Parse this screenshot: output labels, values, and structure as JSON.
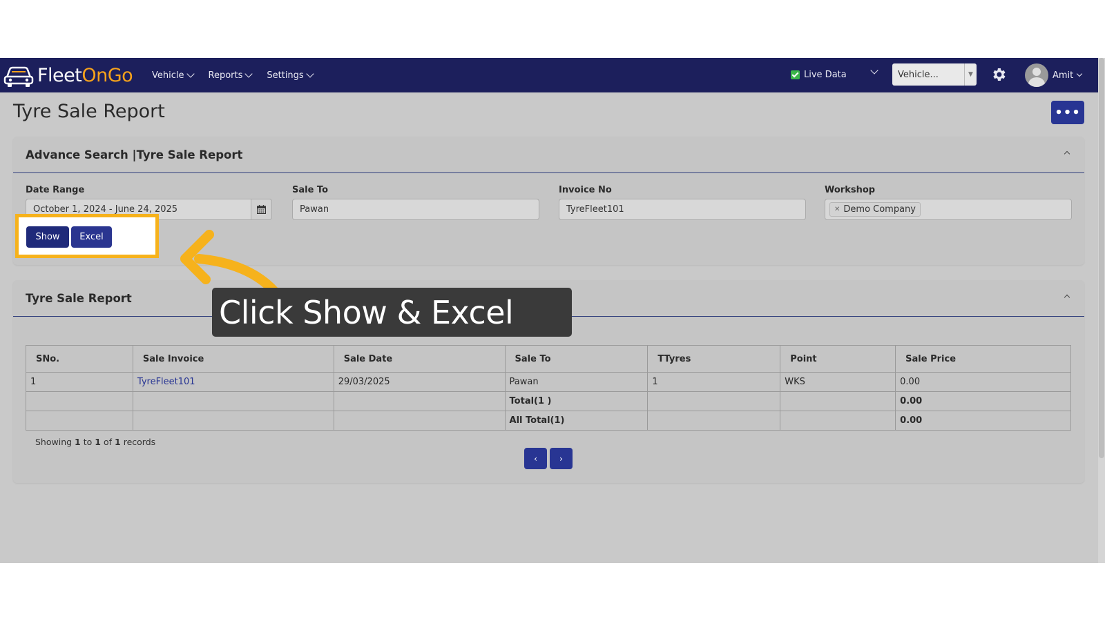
{
  "brand": {
    "fleet": "Fleet",
    "ongo": "OnGo"
  },
  "nav": {
    "items": [
      {
        "label": "Vehicle"
      },
      {
        "label": "Reports"
      },
      {
        "label": "Settings"
      }
    ]
  },
  "header": {
    "live_data_label": "Live Data",
    "vehicle_placeholder": "Vehicle...",
    "user_name": "Amit"
  },
  "page": {
    "title": "Tyre Sale Report",
    "more_label": "•••"
  },
  "search": {
    "title": "Advance Search |Tyre Sale Report",
    "date_range_label": "Date Range",
    "date_range_value": "October 1, 2024 - June 24, 2025",
    "sale_to_label": "Sale To",
    "sale_to_value": "Pawan",
    "invoice_label": "Invoice No",
    "invoice_value": "TyreFleet101",
    "workshop_label": "Workshop",
    "workshop_tag": "Demo Company",
    "show_label": "Show",
    "excel_label": "Excel"
  },
  "report": {
    "title": "Tyre Sale Report",
    "columns": [
      "SNo.",
      "Sale Invoice",
      "Sale Date",
      "Sale To",
      "TTyres",
      "Point",
      "Sale Price"
    ],
    "row": {
      "sno": "1",
      "invoice": "TyreFleet101",
      "date": "29/03/2025",
      "sale_to": "Pawan",
      "tyres": "1",
      "point": "WKS",
      "price": "0.00"
    },
    "total_label": "Total(1 )",
    "total_price": "0.00",
    "all_total_label": "All Total(1)",
    "all_total_price": "0.00",
    "showing_prefix": "Showing",
    "showing_from": "1",
    "showing_to_word": "to",
    "showing_to": "1",
    "showing_of_word": "of",
    "showing_total": "1",
    "showing_suffix": "records",
    "prev_label": "‹",
    "next_label": "›"
  },
  "overlay": {
    "instruction": "Click Show & Excel"
  },
  "colors": {
    "navbar": "#1c1f5c",
    "accent": "#283593",
    "brand_orange": "#f6a21c",
    "highlight": "#f6b21c"
  }
}
